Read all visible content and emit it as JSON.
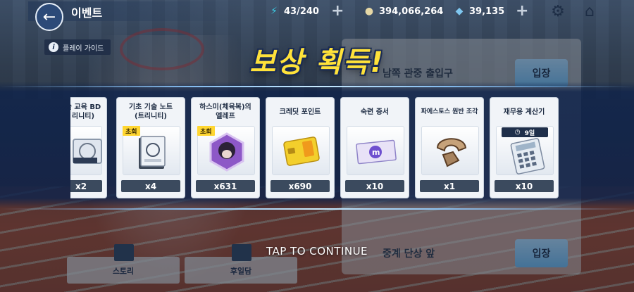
{
  "header": {
    "title": "이벤트",
    "stamina": "43/240",
    "credits": "394,066,264",
    "gems": "39,135"
  },
  "guide": {
    "label": "플레이 가이드"
  },
  "reward_title": "보상 획득!",
  "rewards": [
    {
      "name": "술 교육 BD\n리니티)",
      "qty": "x2"
    },
    {
      "name": "기초 기술 노트\n(트리니티)",
      "qty": "x4",
      "tag": "초회"
    },
    {
      "name": "하스미(체육복)의\n엘레프",
      "qty": "x631",
      "tag": "초회"
    },
    {
      "name": "크레딧 포인트",
      "qty": "x690"
    },
    {
      "name": "숙련 증서",
      "qty": "x10"
    },
    {
      "name": "파에스토스 원반 조각",
      "qty": "x1"
    },
    {
      "name": "재무용 계산기",
      "qty": "x10",
      "duration": "9일"
    }
  ],
  "list": [
    {
      "name": "남쪽 관중 출입구",
      "enter": "입장"
    },
    {
      "name": "중계 단상 앞",
      "enter": "입장"
    }
  ],
  "tabs": {
    "story": "스토리",
    "epilogue": "후일담"
  },
  "tap_to_continue": "TAP TO CONTINUE",
  "colors": {
    "title_yellow": "#ffe23a",
    "banner_navy": "#0f234b",
    "enter_blue": "#6bb8f2"
  }
}
